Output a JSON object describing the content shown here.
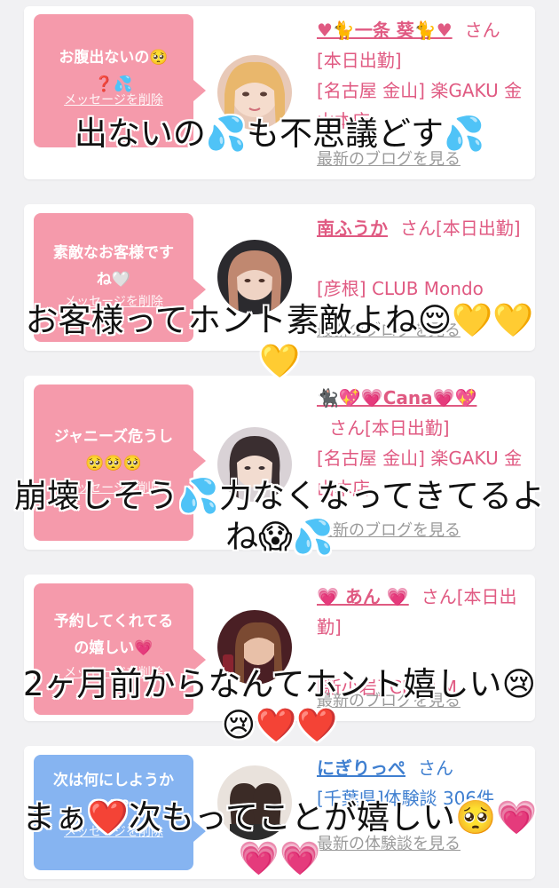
{
  "cards": [
    {
      "bubble_text": "お腹出ないの🥺❓💦",
      "delete_label": "メッセージを削除",
      "name": "♥🐈一条 葵🐈♥",
      "honorific": "さん",
      "status": "[本日出勤]",
      "shop": "[名古屋 金山] 楽GAKU 金山本店",
      "link": "最新のブログを見る",
      "bubble_color": "#f59aab",
      "text_color": "#e05a82"
    },
    {
      "bubble_text": "素敵なお客様ですね🤍",
      "delete_label": "メッセージを削除",
      "name": "南ふうか",
      "honorific": "さん",
      "status": "[本日出勤]",
      "shop": "[彦根] CLUB Mondo",
      "link": "最新のブログを見る",
      "bubble_color": "#f59aab",
      "text_color": "#e05a82"
    },
    {
      "bubble_text": "ジャニーズ危うし🥺🥺🥺",
      "delete_label": "メッセージを削除",
      "name": "🐈‍⬛💖💗Cana💗💖",
      "honorific": "さん",
      "status": "[本日出勤]",
      "shop": "[名古屋 金山] 楽GAKU 金山本店",
      "link": "最新のブログを見る",
      "bubble_color": "#f59aab",
      "text_color": "#e05a82"
    },
    {
      "bubble_text": "予約してくれてるの嬉しい💗",
      "delete_label": "メッセージを削除",
      "name": "💗 あん 💗",
      "honorific": "さん",
      "status": "[本日出勤]",
      "shop": "[新小岩] CLUB M",
      "link": "最新のブログを見る",
      "bubble_color": "#f59aab",
      "text_color": "#e05a82"
    },
    {
      "bubble_text": "次は何にしようかしら？",
      "delete_label": "メッセージを削除",
      "name": "にぎりっぺ",
      "honorific": "さん",
      "status": "",
      "shop": "[千葉県]体験談 306件",
      "link": "最新の体験談を見る",
      "bubble_color": "#86b4f1",
      "text_color": "#3f7fd0"
    }
  ],
  "overlays": [
    "出ないの💦も不思議どす💦",
    "お客様ってホント素敵よね😌💛💛💛",
    "崩壊しそう💦力なくなってきてるよね😱💦",
    "2ヶ月前からなんてホント嬉しい😢😢❤️❤️",
    "まぁ❤️次もってことが嬉しい🥺💗💗💗"
  ]
}
